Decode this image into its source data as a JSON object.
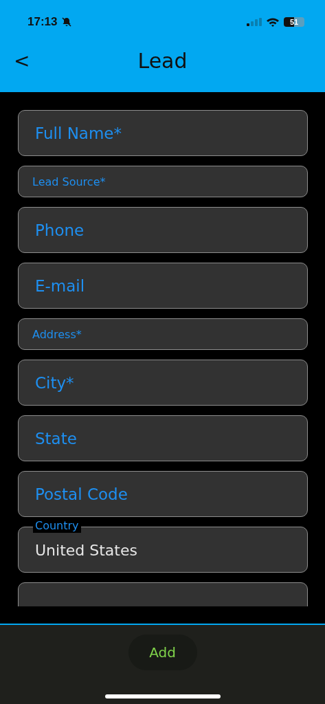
{
  "status_bar": {
    "time": "17:13",
    "battery": "51"
  },
  "header": {
    "back": "<",
    "title": "Lead"
  },
  "fields": [
    {
      "kind": "large",
      "placeholder": "Full Name*"
    },
    {
      "kind": "small",
      "placeholder": "Lead Source*"
    },
    {
      "kind": "large",
      "placeholder": "Phone"
    },
    {
      "kind": "large",
      "placeholder": "E-mail"
    },
    {
      "kind": "small",
      "placeholder": "Address*"
    },
    {
      "kind": "large",
      "placeholder": "City*"
    },
    {
      "kind": "large",
      "placeholder": "State"
    },
    {
      "kind": "large",
      "placeholder": "Postal Code"
    },
    {
      "kind": "floating",
      "label": "Country",
      "value": "United States"
    },
    {
      "kind": "empty"
    }
  ],
  "footer": {
    "button": "Add"
  }
}
